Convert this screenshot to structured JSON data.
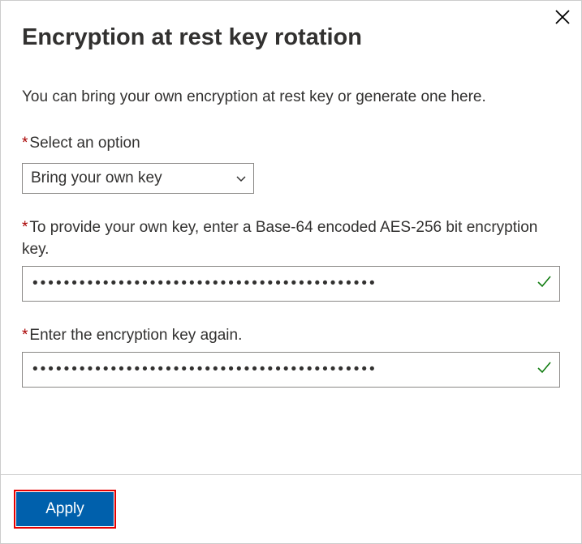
{
  "header": {
    "title": "Encryption at rest key rotation",
    "close_label": "Close"
  },
  "description": "You can bring your own encryption at rest key or generate one here.",
  "fields": {
    "select_option": {
      "label": "Select an option",
      "value": "Bring your own key"
    },
    "key_input": {
      "label": "To provide your own key, enter a Base-64 encoded AES-256 bit encryption key.",
      "value": "●●●●●●●●●●●●●●●●●●●●●●●●●●●●●●●●●●●●●●●●●●●●"
    },
    "key_confirm": {
      "label": "Enter the encryption key again.",
      "value": "●●●●●●●●●●●●●●●●●●●●●●●●●●●●●●●●●●●●●●●●●●●●"
    }
  },
  "footer": {
    "apply_label": "Apply"
  },
  "required_marker": "*"
}
